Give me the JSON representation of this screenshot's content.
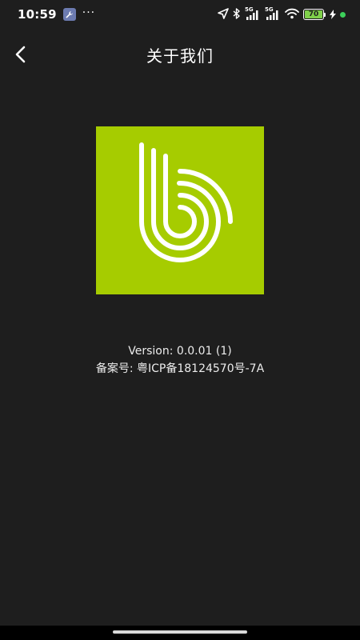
{
  "status_bar": {
    "time": "10:59",
    "more": "···",
    "network_1": "5G",
    "network_2": "5G",
    "battery_level": "70",
    "icons": [
      "wrench-icon",
      "location-arrow-icon",
      "bluetooth-icon",
      "signal-icon",
      "wifi-icon",
      "battery-icon",
      "charging-icon"
    ],
    "battery_color": "#7fd04a",
    "dot_color": "#3ccf5a"
  },
  "header": {
    "title": "关于我们",
    "back_icon": "chevron-left-icon"
  },
  "logo": {
    "background": "#a6cc00",
    "icon": "brand-b-logo"
  },
  "info": {
    "version": "Version: 0.0.01 (1)",
    "icp": "备案号: 粤ICP备18124570号-7A"
  },
  "colors": {
    "background": "#1e1e1e",
    "text": "#ffffff"
  }
}
